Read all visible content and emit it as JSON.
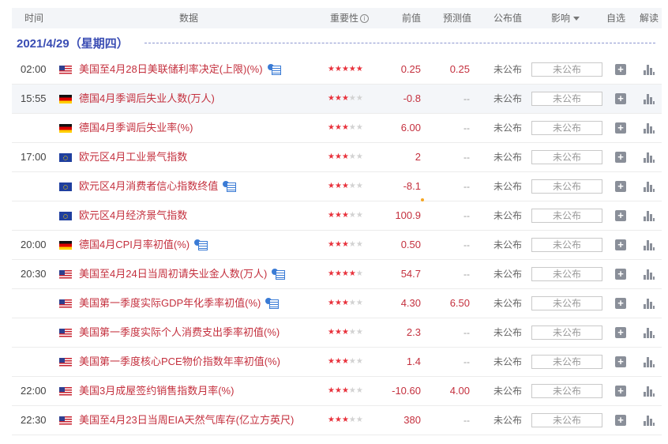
{
  "header": {
    "time": "时间",
    "data": "数据",
    "importance": "重要性",
    "previous": "前值",
    "forecast": "预测值",
    "actual": "公布值",
    "impact": "影响",
    "watch": "自选",
    "interpret": "解读"
  },
  "date_label": "2021/4/29（星期四）",
  "rows": [
    {
      "time": "02:00",
      "flag": "us",
      "name": "美国至4月28日美联储利率决定(上限)(%)",
      "video": true,
      "stars": 5,
      "previous": "0.25",
      "forecast": "0.25",
      "actual": "未公布",
      "impact": "未公布",
      "shade": false
    },
    {
      "time": "15:55",
      "flag": "de",
      "name": "德国4月季调后失业人数(万人)",
      "video": false,
      "stars": 3,
      "previous": "-0.8",
      "forecast": "--",
      "actual": "未公布",
      "impact": "未公布",
      "shade": true
    },
    {
      "time": "",
      "flag": "de",
      "name": "德国4月季调后失业率(%)",
      "video": false,
      "stars": 3,
      "previous": "6.00",
      "forecast": "--",
      "actual": "未公布",
      "impact": "未公布",
      "shade": false
    },
    {
      "time": "17:00",
      "flag": "eu",
      "name": "欧元区4月工业景气指数",
      "video": false,
      "stars": 3,
      "previous": "2",
      "forecast": "--",
      "actual": "未公布",
      "impact": "未公布",
      "shade": false
    },
    {
      "time": "",
      "flag": "eu",
      "name": "欧元区4月消费者信心指数终值",
      "video": true,
      "stars": 3,
      "previous": "-8.1",
      "forecast": "--",
      "actual": "未公布",
      "impact": "未公布",
      "shade": false
    },
    {
      "time": "",
      "flag": "eu",
      "name": "欧元区4月经济景气指数",
      "video": false,
      "stars": 3,
      "previous": "100.9",
      "previous_revised": true,
      "forecast": "--",
      "actual": "未公布",
      "impact": "未公布",
      "shade": false
    },
    {
      "time": "20:00",
      "flag": "de",
      "name": "德国4月CPI月率初值(%)",
      "video": true,
      "stars": 3,
      "previous": "0.50",
      "forecast": "--",
      "actual": "未公布",
      "impact": "未公布",
      "shade": false
    },
    {
      "time": "20:30",
      "flag": "us",
      "name": "美国至4月24日当周初请失业金人数(万人)",
      "video": true,
      "stars": 4,
      "previous": "54.7",
      "forecast": "--",
      "actual": "未公布",
      "impact": "未公布",
      "shade": false
    },
    {
      "time": "",
      "flag": "us",
      "name": "美国第一季度实际GDP年化季率初值(%)",
      "video": true,
      "stars": 3,
      "previous": "4.30",
      "forecast": "6.50",
      "actual": "未公布",
      "impact": "未公布",
      "shade": false
    },
    {
      "time": "",
      "flag": "us",
      "name": "美国第一季度实际个人消费支出季率初值(%)",
      "video": false,
      "stars": 3,
      "previous": "2.3",
      "forecast": "--",
      "actual": "未公布",
      "impact": "未公布",
      "shade": false
    },
    {
      "time": "",
      "flag": "us",
      "name": "美国第一季度核心PCE物价指数年率初值(%)",
      "video": false,
      "stars": 3,
      "previous": "1.4",
      "forecast": "--",
      "actual": "未公布",
      "impact": "未公布",
      "shade": false
    },
    {
      "time": "22:00",
      "flag": "us",
      "name": "美国3月成屋签约销售指数月率(%)",
      "video": false,
      "stars": 3,
      "previous": "-10.60",
      "forecast": "4.00",
      "actual": "未公布",
      "impact": "未公布",
      "shade": false
    },
    {
      "time": "22:30",
      "flag": "us",
      "name": "美国至4月23日当周EIA天然气库存(亿立方英尺)",
      "video": false,
      "stars": 3,
      "previous": "380",
      "forecast": "--",
      "actual": "未公布",
      "impact": "未公布",
      "shade": false
    }
  ],
  "add_symbol": "+",
  "colors": {
    "accent": "#3a4db4",
    "event_text": "#c4303e",
    "star_on": "#e8323c",
    "star_off": "#d2d2d2",
    "header_bg": "#f3f5f8"
  }
}
